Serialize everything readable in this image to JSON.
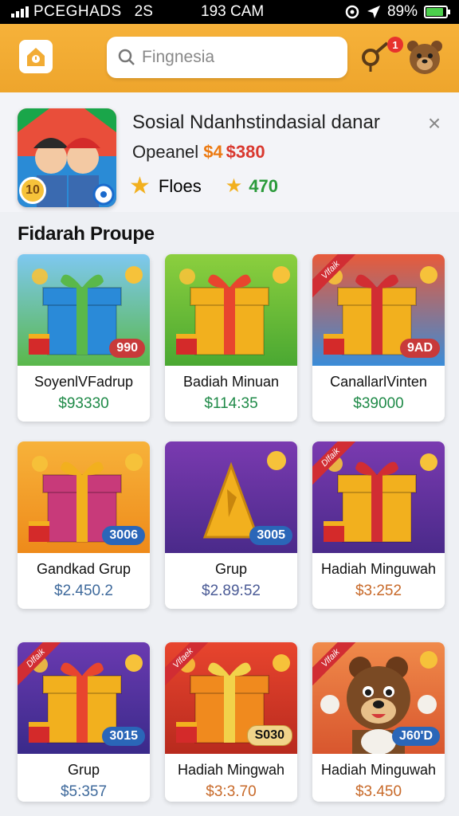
{
  "status_bar": {
    "carrier": "PCEGHADS",
    "network": "2S",
    "time": "193 CAM",
    "battery": "89%",
    "battery_level": 0.89
  },
  "header": {
    "search_placeholder": "Fingnesia",
    "notification_count": "1"
  },
  "featured": {
    "title": "Sosial Ndanhstindasial danar",
    "price_label": "Opeanel",
    "price_1": "$4",
    "price_2": "$380",
    "level_badge": "10",
    "stats_label": "Floes",
    "stats_count": "470"
  },
  "section": {
    "title": "Fidarah Proupe"
  },
  "products": [
    {
      "name": "SoyenlVFadrup",
      "price": "$93330",
      "price_color": "#1f8a48",
      "badge": "990",
      "badge_color": "#c83a3a",
      "ribbon": ""
    },
    {
      "name": "Badiah Minuan",
      "price": "$114:35",
      "price_color": "#1f8a48",
      "badge": "",
      "badge_color": "",
      "ribbon": ""
    },
    {
      "name": "CanallarlVinten",
      "price": "$39000",
      "price_color": "#1f8a48",
      "badge": "9AD",
      "badge_color": "#c83a3a",
      "ribbon": "Vlfaik"
    },
    {
      "name": "Gandkad Grup",
      "price": "$2.450.2",
      "price_color": "#3f6a9c",
      "badge": "3006",
      "badge_color": "#2a66b8",
      "ribbon": ""
    },
    {
      "name": "Grup",
      "price": "$2.89:52",
      "price_color": "#4b5b96",
      "badge": "3005",
      "badge_color": "#2a66b8",
      "ribbon": ""
    },
    {
      "name": "Hadiah Minguwah",
      "price": "$3:252",
      "price_color": "#c86a2a",
      "badge": "",
      "badge_color": "",
      "ribbon": "Dlfaik"
    },
    {
      "name": "Grup",
      "price": "$5:357",
      "price_color": "#3f6a9c",
      "badge": "3015",
      "badge_color": "#2a66b8",
      "ribbon": "Dlfaik"
    },
    {
      "name": "Hadiah Mingwah",
      "price": "$3:3.70",
      "price_color": "#c86a2a",
      "badge": "S030",
      "badge_color": "#f1d48a",
      "ribbon": "Vlfaek"
    },
    {
      "name": "Hadiah Minguwah",
      "price": "$3.450",
      "price_color": "#c86a2a",
      "badge": "J60'D",
      "badge_color": "#2a66b8",
      "ribbon": "Vlfaik"
    }
  ],
  "colors": {
    "header": "#f2ac34",
    "accent_green": "#1f8a48",
    "accent_orange": "#ec7a12"
  }
}
